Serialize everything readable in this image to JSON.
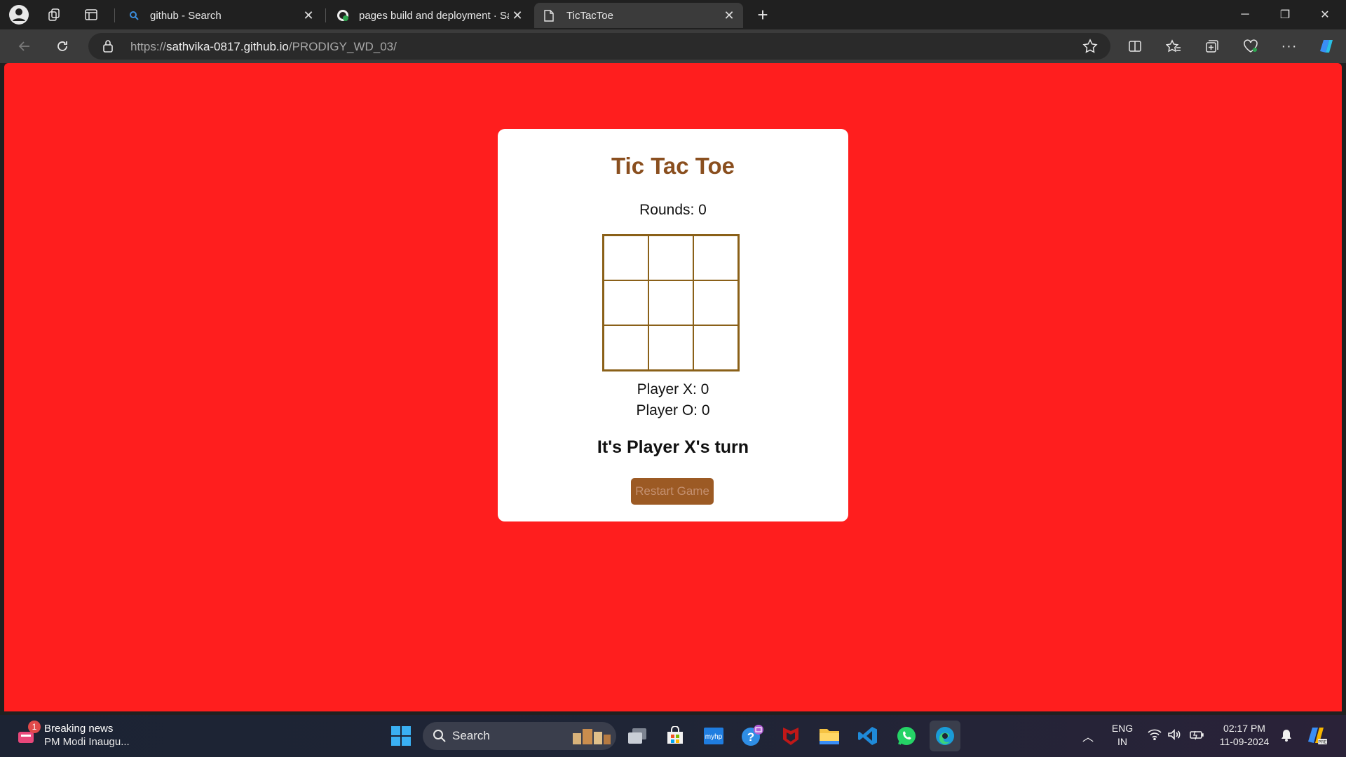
{
  "browser": {
    "tabs": [
      {
        "label": "github - Search",
        "active": false
      },
      {
        "label": "pages build and deployment · Sat",
        "active": false
      },
      {
        "label": "TicTacToe",
        "active": true
      }
    ],
    "url": {
      "scheme": "https://",
      "host": "sathvika-0817.github.io",
      "path": "/PRODIGY_WD_03/"
    }
  },
  "page": {
    "background": "#ff1e1e",
    "title": "Tic Tac Toe",
    "rounds": "Rounds: 0",
    "board": [
      "",
      "",
      "",
      "",
      "",
      "",
      "",
      "",
      ""
    ],
    "player_x": "Player X: 0",
    "player_o": "Player O: 0",
    "status": "It's Player X's turn",
    "restart_label": "Restart Game"
  },
  "taskbar": {
    "news_title": "Breaking news",
    "news_sub": "PM Modi Inaugu...",
    "news_badge": "1",
    "search_label": "Search",
    "lang_top": "ENG",
    "lang_bottom": "IN",
    "time": "02:17 PM",
    "date": "11-09-2024",
    "apps": [
      "task-view",
      "microsoft-store",
      "myhp",
      "get-help",
      "mcafee",
      "file-explorer",
      "vs-code",
      "whatsapp",
      "edge"
    ]
  }
}
